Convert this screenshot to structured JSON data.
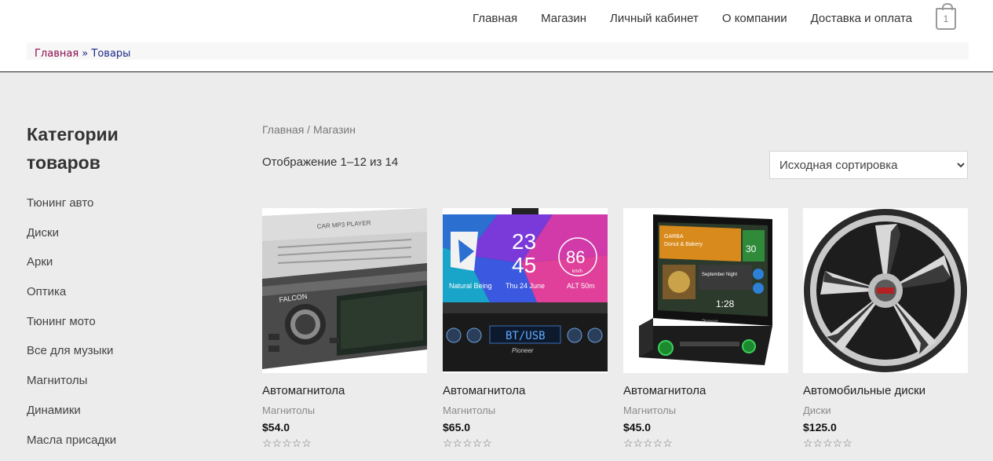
{
  "nav": {
    "items": [
      "Главная",
      "Магазин",
      "Личный кабинет",
      "О компании",
      "Доставка и оплата"
    ],
    "cart_count": "1"
  },
  "breadcrumb_top": {
    "home": "Главная",
    "sep": "»",
    "current": "Товары"
  },
  "sidebar": {
    "title": "Категории товаров",
    "categories": [
      "Тюнинг авто",
      "Диски",
      "Арки",
      "Оптика",
      "Тюнинг мото",
      "Все для музыки",
      "Магнитолы",
      "Динамики",
      "Масла присадки"
    ]
  },
  "shop": {
    "breadcrumb": {
      "home": "Главная",
      "sep": " / ",
      "current": "Магазин"
    },
    "result_count": "Отображение 1–12 из 14",
    "sort_selected": "Исходная сортировка"
  },
  "products": [
    {
      "name": "Автомагнитола",
      "category": "Магнитолы",
      "price": "$54.0",
      "rating": "☆☆☆☆☆"
    },
    {
      "name": "Автомагнитола",
      "category": "Магнитолы",
      "price": "$65.0",
      "rating": "☆☆☆☆☆"
    },
    {
      "name": "Автомагнитола",
      "category": "Магнитолы",
      "price": "$45.0",
      "rating": "☆☆☆☆☆"
    },
    {
      "name": "Автомобильные диски",
      "category": "Диски",
      "price": "$125.0",
      "rating": "☆☆☆☆☆"
    }
  ],
  "image_text": {
    "p1_brand": "FALCON",
    "p1_model": "CAR MP3 PLAYER",
    "p2_time1": "23",
    "p2_time2": "45",
    "p2_speed": "86",
    "p2_speed_unit": "km/h",
    "p2_left": "Natural Being",
    "p2_mid": "Thu 24 June",
    "p2_right": "ALT 50m",
    "p2_display": "BT/USB",
    "p2_brand": "Pioneer",
    "p3_artist": "GARBA",
    "p3_album": "Donut & Bakery",
    "p3_song": "September Night",
    "p3_time": "1:28",
    "p3_temp": "30",
    "p3_brand": "Pioneer"
  }
}
